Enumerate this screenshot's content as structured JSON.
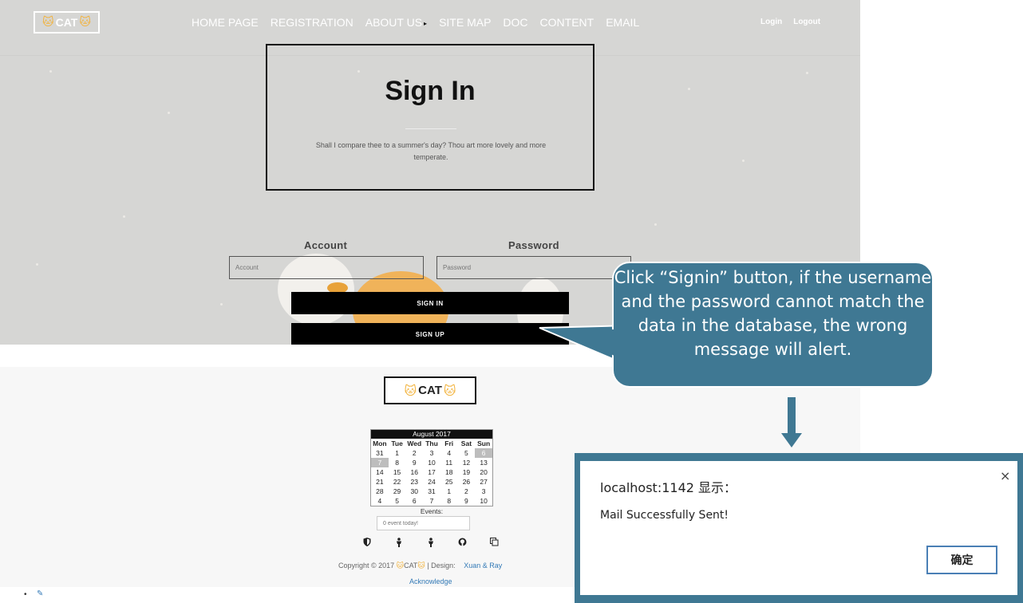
{
  "header": {
    "logo_text": "CAT",
    "logo_emoji": "🐱",
    "nav_items": [
      "HOME PAGE",
      "REGISTRATION",
      "ABOUT US",
      "SITE MAP",
      "DOC",
      "CONTENT",
      "EMAIL"
    ],
    "about_caret": "▸",
    "login_label": "Login",
    "logout_label": "Logout"
  },
  "signin_card": {
    "title": "Sign In",
    "quote": "Shall I compare thee to a summer's day? Thou art more lovely and more temperate."
  },
  "form": {
    "account_label": "Account",
    "account_placeholder": "Account",
    "password_label": "Password",
    "password_placeholder": "Password",
    "signin_button": "SIGN IN",
    "signup_button": "SIGN UP"
  },
  "footer": {
    "logo_text": "CAT",
    "calendar": {
      "title": "August 2017",
      "weekdays": [
        "Mon",
        "Tue",
        "Wed",
        "Thu",
        "Fri",
        "Sat",
        "Sun"
      ],
      "weeks": [
        [
          "31",
          "1",
          "2",
          "3",
          "4",
          "5",
          "6"
        ],
        [
          "7",
          "8",
          "9",
          "10",
          "11",
          "12",
          "13"
        ],
        [
          "14",
          "15",
          "16",
          "17",
          "18",
          "19",
          "20"
        ],
        [
          "21",
          "22",
          "23",
          "24",
          "25",
          "26",
          "27"
        ],
        [
          "28",
          "29",
          "30",
          "31",
          "1",
          "2",
          "3"
        ],
        [
          "4",
          "5",
          "6",
          "7",
          "8",
          "9",
          "10"
        ]
      ]
    },
    "events_label": "Events:",
    "events_placeholder": "0 event today!",
    "social_icons": [
      "shield-icon",
      "person-icon",
      "person-icon",
      "github-icon",
      "copy-icon"
    ],
    "copyright_prefix": "Copyright © 2017",
    "copyright_brand": "CAT",
    "design_label": "| Design:",
    "designers": "Xuan & Ray",
    "acknowledge": "Acknowledge",
    "bullet": "•",
    "edit_icon": "pencil-icon"
  },
  "callout": {
    "text": "Click “Signin” button, if the username and the password cannot match the data in the database, the wrong message will alert.",
    "color": "#3f7893"
  },
  "dialog": {
    "title": "localhost:1142 显示：",
    "message": "Mail Successfully Sent!",
    "ok_label": "确定",
    "close_glyph": "×"
  }
}
